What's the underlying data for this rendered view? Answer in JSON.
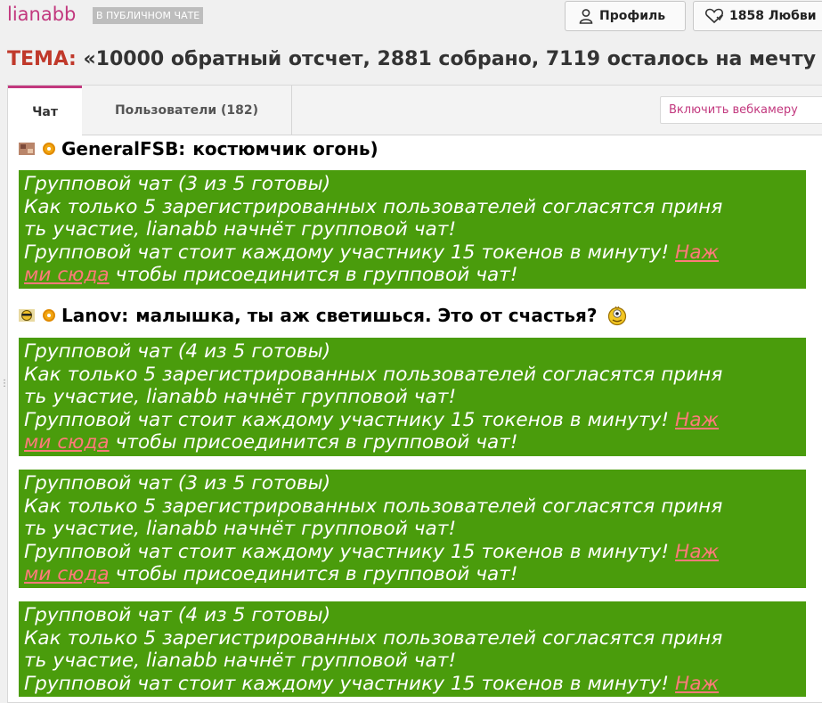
{
  "header": {
    "username": "lianabb",
    "mode_badge": "В ПУБЛИЧНОМ ЧАТЕ",
    "profile_label": "Профиль",
    "fans_label": "1858 Любви",
    "icons": {
      "profile": "user-icon",
      "fans": "heart-icon"
    }
  },
  "topic": {
    "label": "ТЕМА:",
    "text": "«10000 обратный отсчет, 2881 собрано, 7119 осталось на мечту"
  },
  "tabs": {
    "chat": "Чат",
    "users": "Пользователи (182)",
    "webcam_button": "Включить вебкамеру"
  },
  "colors": {
    "accent": "#c2387e",
    "notice_bg": "#4a9c0c",
    "topic_label": "#c0392b",
    "link": "#ff7a7a"
  },
  "messages": [
    {
      "type": "user",
      "author": "GeneralFSB:",
      "text": "костюмчик огонь)",
      "avatar": "avatar-icon"
    },
    {
      "type": "notice",
      "line1": "Групповой чат (3 из 5 готовы)",
      "line2": "Как только 5 зарегистрированных пользователей согласятся приня",
      "line3": "ть участие, lianabb начнёт групповой чат!",
      "line4_before": "Групповой чат стоит каждому участнику 15 токенов в минуту! ",
      "link_part1": "Наж",
      "link_part2": "ми сюда",
      "line5_after": " чтобы присоединится в групповой чат!"
    },
    {
      "type": "user",
      "author": "Lanov:",
      "text": "малышка, ты аж светишься. Это от счастья?",
      "avatar": "avatar-icon",
      "emoji": "smiley-icon"
    },
    {
      "type": "notice",
      "line1": "Групповой чат (4 из 5 готовы)",
      "line2": "Как только 5 зарегистрированных пользователей согласятся приня",
      "line3": "ть участие, lianabb начнёт групповой чат!",
      "line4_before": "Групповой чат стоит каждому участнику 15 токенов в минуту! ",
      "link_part1": "Наж",
      "link_part2": "ми сюда",
      "line5_after": " чтобы присоединится в групповой чат!"
    },
    {
      "type": "notice",
      "line1": "Групповой чат (3 из 5 готовы)",
      "line2": "Как только 5 зарегистрированных пользователей согласятся приня",
      "line3": "ть участие, lianabb начнёт групповой чат!",
      "line4_before": "Групповой чат стоит каждому участнику 15 токенов в минуту! ",
      "link_part1": "Наж",
      "link_part2": "ми сюда",
      "line5_after": " чтобы присоединится в групповой чат!"
    },
    {
      "type": "notice",
      "line1": "Групповой чат (4 из 5 готовы)",
      "line2": "Как только 5 зарегистрированных пользователей согласятся приня",
      "line3": "ть участие, lianabb начнёт групповой чат!",
      "line4_before": "Групповой чат стоит каждому участнику 15 токенов в минуту! ",
      "link_part1": "Наж"
    }
  ]
}
